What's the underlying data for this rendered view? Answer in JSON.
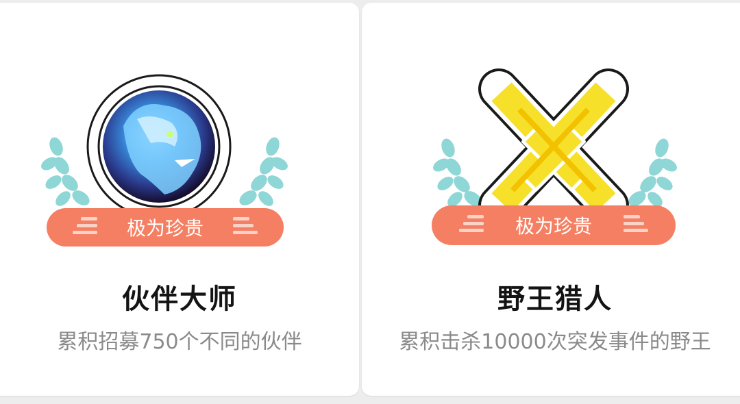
{
  "colors": {
    "page_bg": "#ededed",
    "card_bg": "#ffffff",
    "banner": "#f57f62",
    "banner_text": "#ffffff",
    "laurel": "#8fd6d6",
    "title": "#141414",
    "description": "#8a8a8a",
    "sword_yellow": "#f7e02a"
  },
  "achievements": [
    {
      "icon": "blue-dragon-portrait-icon",
      "rarity": "极为珍贵",
      "title": "伙伴大师",
      "description": "累积招募750个不同的伙伴"
    },
    {
      "icon": "crossed-swords-icon",
      "rarity": "极为珍贵",
      "title": "野王猎人",
      "description": "累积击杀10000次突发事件的野王"
    }
  ]
}
